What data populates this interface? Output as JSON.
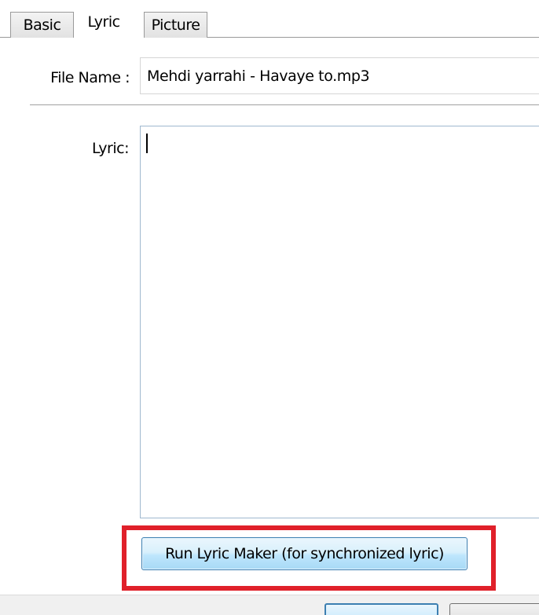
{
  "tabs": [
    {
      "label": "Basic",
      "active": false
    },
    {
      "label": "Lyric",
      "active": true
    },
    {
      "label": "Picture",
      "active": false
    }
  ],
  "file_name": {
    "label": "File Name :",
    "value": "Mehdi yarrahi - Havaye to.mp3"
  },
  "lyric": {
    "label": "Lyric:",
    "value": ""
  },
  "run_lyric_maker": {
    "label": "Run Lyric Maker (for synchronized lyric)"
  },
  "colors": {
    "highlight": "#e0202a",
    "button_border": "#3c7fb1",
    "field_border": "#9fb8cf"
  }
}
